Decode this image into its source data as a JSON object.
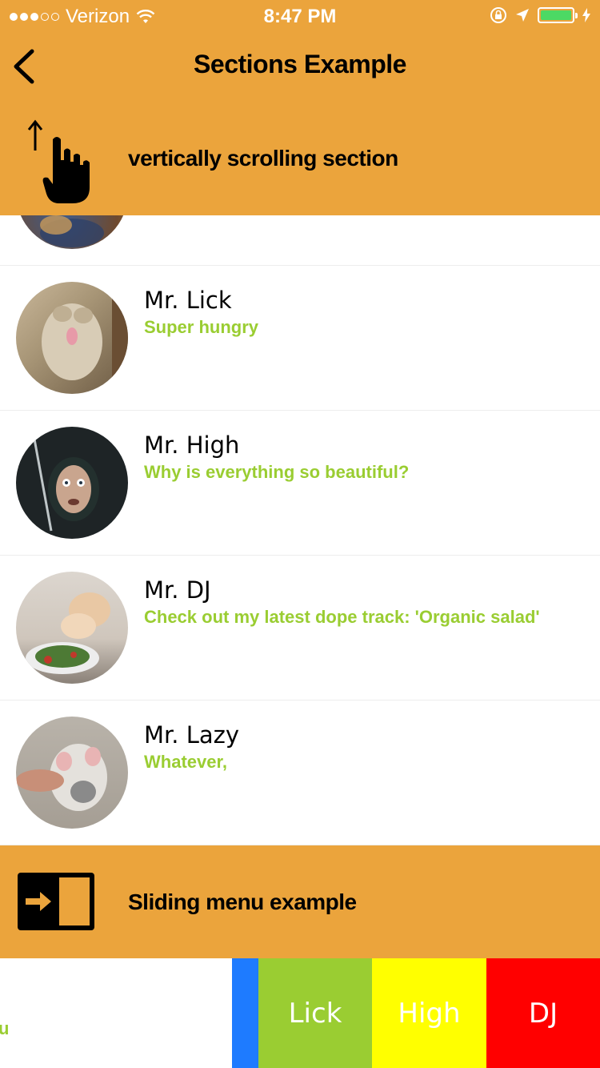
{
  "status_bar": {
    "carrier": "Verizon",
    "time": "8:47 PM",
    "signal_bars_filled": 3,
    "signal_bars_total": 5,
    "battery_level": 1.0
  },
  "nav": {
    "title": "Sections Example",
    "back_icon": "chevron-left-icon"
  },
  "section_header": {
    "title": "vertically scrolling section",
    "icon": "swipe-up-hand-icon"
  },
  "list": {
    "items": [
      {
        "name": "Mr. Lick",
        "status": "Super hungry"
      },
      {
        "name": "Mr. High",
        "status": "Why is everything so beautiful?"
      },
      {
        "name": "Mr. DJ",
        "status": "Check out my latest dope track: 'Organic salad'"
      },
      {
        "name": "Mr. Lazy",
        "status": "Whatever,"
      }
    ]
  },
  "sliding_header": {
    "title": "Sliding menu example",
    "icon": "sliding-menu-icon"
  },
  "swipe_row": {
    "partial_status": "u",
    "actions": [
      {
        "label": "",
        "color": "#1E7BFF"
      },
      {
        "label": "Lick",
        "color": "#9ACD32"
      },
      {
        "label": "High",
        "color": "#FFFF00"
      },
      {
        "label": "DJ",
        "color": "#FF0000"
      }
    ]
  },
  "colors": {
    "header_bg": "#EBA43C",
    "status_green": "#9ACD32"
  }
}
